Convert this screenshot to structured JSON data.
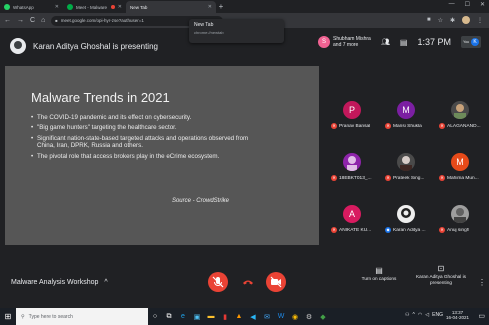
{
  "browser": {
    "tabs": [
      {
        "label": "WhatsApp",
        "fav_color": "#25d366"
      },
      {
        "label": "Meet - Malware Analysis W...",
        "fav_color": "#00ac47"
      },
      {
        "label": "New Tab",
        "fav_color": "#9aa0a6"
      }
    ],
    "hover_card": {
      "title": "New Tab",
      "url": "chrome://newtab"
    },
    "url": "meet.google.com/opi-hyr-zse?authuser=1",
    "nav": {
      "back": "←",
      "forward": "→",
      "reload": "C",
      "home": "⌂",
      "lock": "🔒"
    },
    "window_controls": {
      "min": "—",
      "max": "☐",
      "close": "✕"
    }
  },
  "meet": {
    "presenting_text": "Karan Aditya Ghoshal is presenting",
    "chip": {
      "initial": "S",
      "text": "Shubham Mishra and 7 more"
    },
    "time": "1:37 PM",
    "self": {
      "label": "You",
      "initial": "K"
    },
    "meeting_title": "Malware Analysis Workshop",
    "caret": "^",
    "captions_label": "Turn on captions",
    "presenter_label": "Karan Aditya Ghoshal is presenting"
  },
  "slide": {
    "title": "Malware Trends in 2021",
    "bullets": [
      "The COVID-19 pandemic and its effect on cybersecurity.",
      "\"Big game hunters\" targeting the healthcare sector.",
      "Significant nation-state-based targeted attacks and operations observed from China, Iran, DPRK, Russia and others.",
      "The pivotal role that access brokers play in the eCrime ecosystem."
    ],
    "source": "Source - CrowdStrike"
  },
  "participants": [
    {
      "name": "Pranav Bansal",
      "initial": "P",
      "color": "#c2185b"
    },
    {
      "name": "Mansi Shukla",
      "initial": "M",
      "color": "#7b1fa2"
    },
    {
      "name": "ALAGANAND...",
      "initial": "",
      "color": "#4a4a4a"
    },
    {
      "name": "18EBKT013_...",
      "initial": "",
      "color": "#8e24aa"
    },
    {
      "name": "Prateek Sing...",
      "initial": "",
      "color": "#4a4a4a"
    },
    {
      "name": "Mahima Mun...",
      "initial": "M",
      "color": "#e64a19"
    },
    {
      "name": "ANIKATE KU...",
      "initial": "A",
      "color": "#d81b60"
    },
    {
      "name": "Karan Aditya ...",
      "initial": "",
      "color": "#4a4a4a"
    },
    {
      "name": "Anuj singh",
      "initial": "",
      "color": "#4a4a4a"
    }
  ],
  "taskbar": {
    "search_placeholder": "Type here to search",
    "time": "13:37",
    "date": "16-04-2021",
    "lang": "ENG"
  }
}
